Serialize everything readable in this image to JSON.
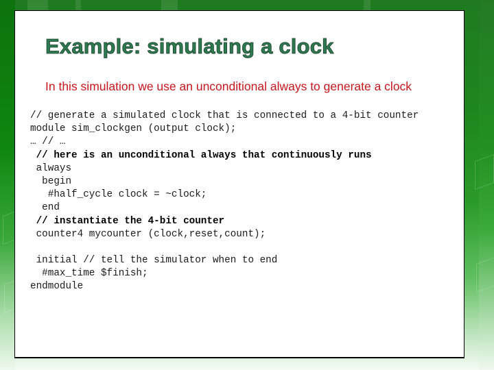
{
  "slide": {
    "title": "Example: simulating a clock",
    "subtitle": "In this simulation we use an unconditional always to generate a clock",
    "colors": {
      "title": "#2e7a50",
      "subtitle": "#c8161d",
      "background_green": "#1e861e",
      "code_text": "#1a1a1a"
    },
    "code_lines": [
      {
        "text": "// generate a simulated clock that is connected to a 4-bit counter",
        "bold": false
      },
      {
        "text": "module sim_clockgen (output clock);",
        "bold": false
      },
      {
        "text": "… // …",
        "bold": false
      },
      {
        "text": " // here is an unconditional always that continuously runs",
        "bold": true
      },
      {
        "text": " always",
        "bold": false
      },
      {
        "text": "  begin",
        "bold": false
      },
      {
        "text": "   #half_cycle clock = ~clock;",
        "bold": false
      },
      {
        "text": "  end",
        "bold": false
      },
      {
        "text": " // instantiate the 4-bit counter",
        "bold": true
      },
      {
        "text": " counter4 mycounter (clock,reset,count);",
        "bold": false
      },
      {
        "text": "",
        "bold": false
      },
      {
        "text": " initial // tell the simulator when to end",
        "bold": false
      },
      {
        "text": "  #max_time $finish;",
        "bold": false
      },
      {
        "text": "endmodule",
        "bold": false
      }
    ]
  }
}
